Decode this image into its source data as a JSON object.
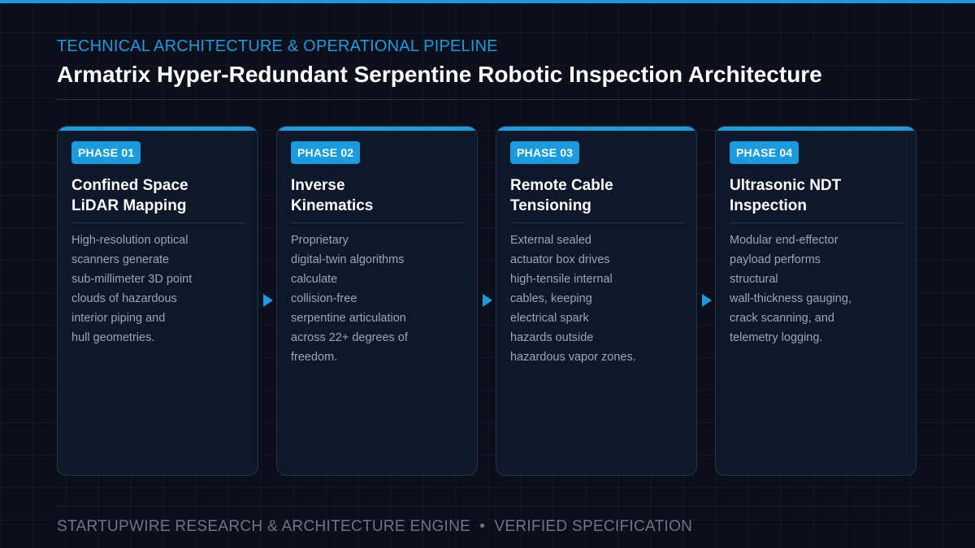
{
  "header": {
    "eyebrow": "TECHNICAL ARCHITECTURE & OPERATIONAL PIPELINE",
    "title": "Armatrix Hyper-Redundant Serpentine Robotic Inspection Architecture"
  },
  "phases": [
    {
      "badge": "PHASE 01",
      "title": "Confined Space\nLiDAR Mapping",
      "description": "High-resolution optical\nscanners generate\nsub-millimeter 3D point\nclouds of hazardous\ninterior piping and\nhull geometries."
    },
    {
      "badge": "PHASE 02",
      "title": "Inverse\nKinematics",
      "description": "Proprietary\ndigital-twin algorithms\ncalculate\ncollision-free\nserpentine articulation\nacross 22+ degrees of\nfreedom."
    },
    {
      "badge": "PHASE 03",
      "title": "Remote Cable\nTensioning",
      "description": "External sealed\nactuator box drives\nhigh-tensile internal\ncables, keeping\nelectrical spark\nhazards outside\nhazardous vapor zones."
    },
    {
      "badge": "PHASE 04",
      "title": "Ultrasonic NDT\nInspection",
      "description": "Modular end-effector\npayload performs\nstructural\nwall-thickness gauging,\ncrack scanning, and\ntelemetry logging."
    }
  ],
  "footer": {
    "text": "STARTUPWIRE RESEARCH & ARCHITECTURE ENGINE  •  VERIFIED SPECIFICATION"
  },
  "colors": {
    "accent": "#1a9be0",
    "background": "#0a0f1a",
    "card": "#0f172a",
    "muted_text": "#9aa5b6"
  },
  "icons": {
    "connector": "triangle-right-icon"
  }
}
